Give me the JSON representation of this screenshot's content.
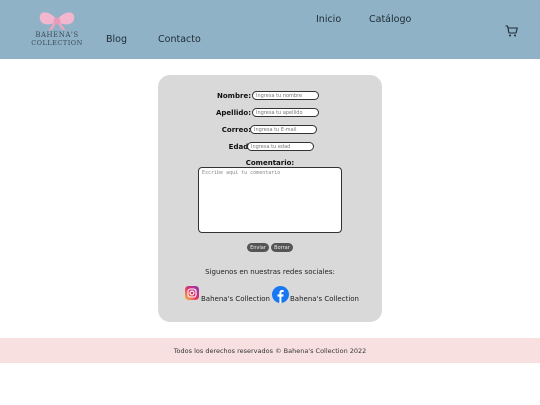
{
  "brand": {
    "line1": "BAHENA'S",
    "line2": "COLLECTION"
  },
  "nav": {
    "blog": "Blog",
    "contacto": "Contacto",
    "inicio": "Inicio",
    "catalogo": "Catálogo"
  },
  "form": {
    "nombre_label": "Nombre:",
    "nombre_placeholder": "Ingresa tu nombre",
    "apellido_label": "Apellido:",
    "apellido_placeholder": "Ingresa tu apellido",
    "correo_label": "Correo:",
    "correo_placeholder": "Ingresa tu E-mail",
    "edad_label": "Edad:",
    "edad_placeholder": "Ingresa tu edad",
    "comentario_label": "Comentario:",
    "comentario_placeholder": "Escribe aquí tu comentario",
    "enviar": "Enviar",
    "borrar": "Borrar"
  },
  "social": {
    "title": "Siguenos en nuestras redes sociales:",
    "instagram_label": "Bahena's Collection",
    "facebook_label": "Bahena's Collection"
  },
  "footer": {
    "text": "Todos los derechos reservados © Bahena's Collection 2022"
  },
  "colors": {
    "header": "#8fb2c7",
    "card": "#d9d9d9",
    "footer": "#f9e0e0",
    "logo_pink": "#f2b7cf",
    "facebook_blue": "#1877f2"
  }
}
